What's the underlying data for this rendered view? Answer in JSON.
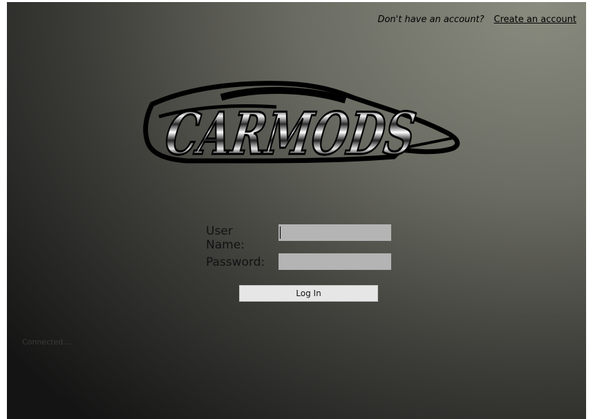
{
  "header": {
    "prompt": "Don't have an account?",
    "create_link": "Create an account"
  },
  "logo": {
    "text": "CARMODS"
  },
  "form": {
    "username_label": "User Name:",
    "username_value": "",
    "password_label": "Password:",
    "password_value": "",
    "login_label": "Log In"
  },
  "status": {
    "text": "Connected...."
  },
  "colors": {
    "input_bg": "#b4b4b4",
    "button_bg": "#e6e6e6",
    "bg_light": "#8a8c80",
    "bg_dark": "#141414"
  }
}
